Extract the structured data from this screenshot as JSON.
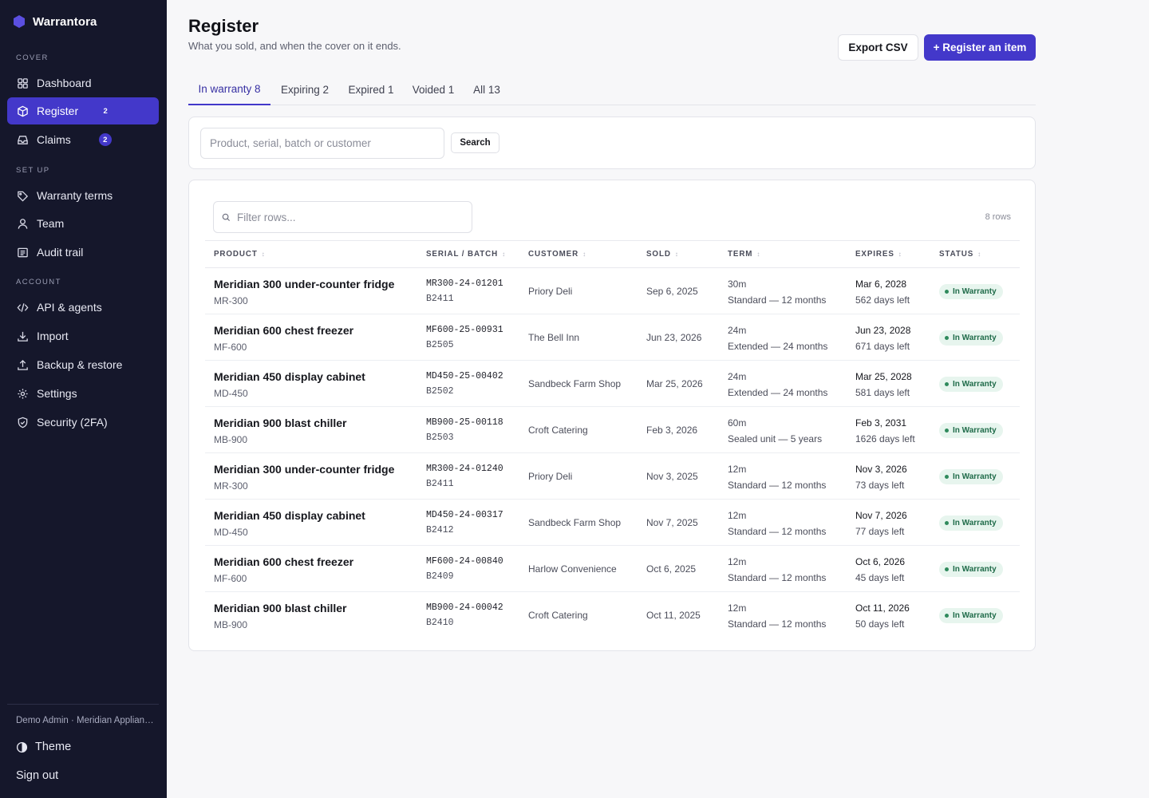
{
  "app": {
    "name": "Warrantora",
    "brand_color": "#4338ca"
  },
  "sidebar": {
    "sections": [
      {
        "label": "COVER"
      },
      {
        "label": "SET UP"
      },
      {
        "label": "ACCOUNT"
      }
    ],
    "items": [
      {
        "label": "Dashboard",
        "icon": "grid-icon"
      },
      {
        "label": "Register",
        "icon": "box-icon",
        "badge": "2",
        "active": true
      },
      {
        "label": "Claims",
        "icon": "inbox-icon",
        "badge": "2"
      },
      {
        "label": "Warranty terms",
        "icon": "tag-icon"
      },
      {
        "label": "Team",
        "icon": "user-icon"
      },
      {
        "label": "Audit trail",
        "icon": "list-icon"
      },
      {
        "label": "API & agents",
        "icon": "code-icon"
      },
      {
        "label": "Import",
        "icon": "download-icon"
      },
      {
        "label": "Backup & restore",
        "icon": "upload-icon"
      },
      {
        "label": "Settings",
        "icon": "gear-icon"
      },
      {
        "label": "Security (2FA)",
        "icon": "shield-icon"
      }
    ],
    "account_line": "Demo Admin · Meridian Appliances",
    "theme_label": "Theme",
    "signout_label": "Sign out"
  },
  "header": {
    "title": "Register",
    "subtitle": "What you sold, and when the cover on it ends.",
    "export_label": "Export CSV",
    "register_label": "+ Register an item"
  },
  "tabs": [
    {
      "label": "In warranty 8",
      "active": true
    },
    {
      "label": "Expiring 2"
    },
    {
      "label": "Expired 1"
    },
    {
      "label": "Voided 1"
    },
    {
      "label": "All 13"
    }
  ],
  "search": {
    "placeholder": "Product, serial, batch or customer",
    "button_label": "Search"
  },
  "table": {
    "filter_placeholder": "Filter rows...",
    "row_count": "8 rows",
    "columns": [
      "PRODUCT",
      "SERIAL / BATCH",
      "CUSTOMER",
      "SOLD",
      "TERM",
      "EXPIRES",
      "STATUS"
    ],
    "sort_glyph": "↕",
    "rows": [
      {
        "product": "Meridian 300 under-counter fridge",
        "model": "MR-300",
        "serial": "MR300-24-01201",
        "batch": "B2411",
        "customer": "Priory Deli",
        "sold": "Sep 6, 2025",
        "term": "30m",
        "term_desc": "Standard — 12 months",
        "expires": "Mar 6, 2028",
        "days_left": "562 days left",
        "status": "In Warranty"
      },
      {
        "product": "Meridian 600 chest freezer",
        "model": "MF-600",
        "serial": "MF600-25-00931",
        "batch": "B2505",
        "customer": "The Bell Inn",
        "sold": "Jun 23, 2026",
        "term": "24m",
        "term_desc": "Extended — 24 months",
        "expires": "Jun 23, 2028",
        "days_left": "671 days left",
        "status": "In Warranty"
      },
      {
        "product": "Meridian 450 display cabinet",
        "model": "MD-450",
        "serial": "MD450-25-00402",
        "batch": "B2502",
        "customer": "Sandbeck Farm Shop",
        "sold": "Mar 25, 2026",
        "term": "24m",
        "term_desc": "Extended — 24 months",
        "expires": "Mar 25, 2028",
        "days_left": "581 days left",
        "status": "In Warranty"
      },
      {
        "product": "Meridian 900 blast chiller",
        "model": "MB-900",
        "serial": "MB900-25-00118",
        "batch": "B2503",
        "customer": "Croft Catering",
        "sold": "Feb 3, 2026",
        "term": "60m",
        "term_desc": "Sealed unit — 5 years",
        "expires": "Feb 3, 2031",
        "days_left": "1626 days left",
        "status": "In Warranty"
      },
      {
        "product": "Meridian 300 under-counter fridge",
        "model": "MR-300",
        "serial": "MR300-24-01240",
        "batch": "B2411",
        "customer": "Priory Deli",
        "sold": "Nov 3, 2025",
        "term": "12m",
        "term_desc": "Standard — 12 months",
        "expires": "Nov 3, 2026",
        "days_left": "73 days left",
        "status": "In Warranty"
      },
      {
        "product": "Meridian 450 display cabinet",
        "model": "MD-450",
        "serial": "MD450-24-00317",
        "batch": "B2412",
        "customer": "Sandbeck Farm Shop",
        "sold": "Nov 7, 2025",
        "term": "12m",
        "term_desc": "Standard — 12 months",
        "expires": "Nov 7, 2026",
        "days_left": "77 days left",
        "status": "In Warranty"
      },
      {
        "product": "Meridian 600 chest freezer",
        "model": "MF-600",
        "serial": "MF600-24-00840",
        "batch": "B2409",
        "customer": "Harlow Convenience",
        "sold": "Oct 6, 2025",
        "term": "12m",
        "term_desc": "Standard — 12 months",
        "expires": "Oct 6, 2026",
        "days_left": "45 days left",
        "status": "In Warranty"
      },
      {
        "product": "Meridian 900 blast chiller",
        "model": "MB-900",
        "serial": "MB900-24-00042",
        "batch": "B2410",
        "customer": "Croft Catering",
        "sold": "Oct 11, 2025",
        "term": "12m",
        "term_desc": "Standard — 12 months",
        "expires": "Oct 11, 2026",
        "days_left": "50 days left",
        "status": "In Warranty"
      }
    ]
  },
  "colors": {
    "sidebar_bg": "#15172b",
    "accent": "#4338ca",
    "status_bg": "#e7f5ee",
    "status_text": "#1f6b49"
  }
}
